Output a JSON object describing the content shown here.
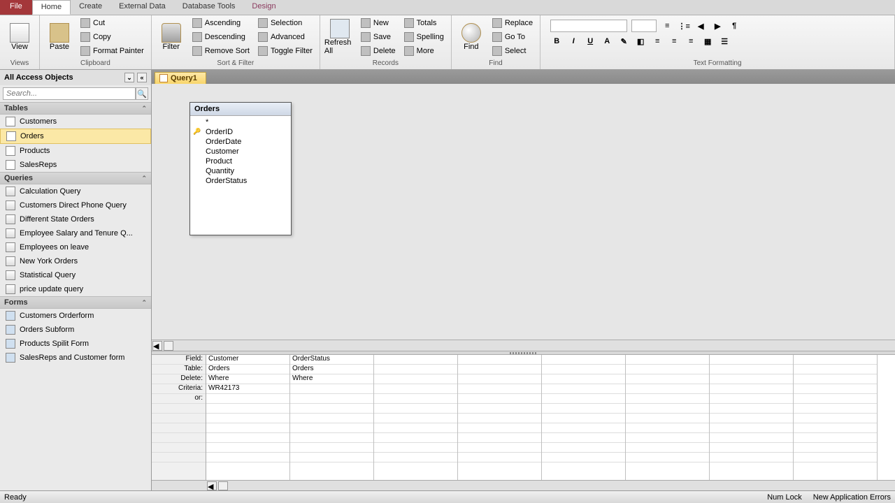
{
  "ribbon": {
    "tabs": {
      "file": "File",
      "home": "Home",
      "create": "Create",
      "external": "External Data",
      "dbtools": "Database Tools",
      "design": "Design"
    },
    "views": {
      "view": "View",
      "group": "Views"
    },
    "clipboard": {
      "paste": "Paste",
      "cut": "Cut",
      "copy": "Copy",
      "format_painter": "Format Painter",
      "group": "Clipboard"
    },
    "sortfilter": {
      "filter": "Filter",
      "ascending": "Ascending",
      "descending": "Descending",
      "remove_sort": "Remove Sort",
      "selection": "Selection",
      "advanced": "Advanced",
      "toggle_filter": "Toggle Filter",
      "group": "Sort & Filter"
    },
    "records": {
      "refresh": "Refresh All",
      "new": "New",
      "save": "Save",
      "delete": "Delete",
      "totals": "Totals",
      "spelling": "Spelling",
      "more": "More",
      "group": "Records"
    },
    "find": {
      "find": "Find",
      "replace": "Replace",
      "goto": "Go To",
      "select": "Select",
      "group": "Find"
    },
    "text": {
      "group": "Text Formatting"
    }
  },
  "sidebar": {
    "title": "All Access Objects",
    "search_placeholder": "Search...",
    "sections": {
      "tables": {
        "label": "Tables",
        "items": [
          "Customers",
          "Orders",
          "Products",
          "SalesReps"
        ]
      },
      "queries": {
        "label": "Queries",
        "items": [
          "Calculation Query",
          "Customers Direct Phone Query",
          "Different State Orders",
          "Employee Salary and Tenure Q...",
          "Employees on leave",
          "New York Orders",
          "Statistical Query",
          "price update query"
        ]
      },
      "forms": {
        "label": "Forms",
        "items": [
          "Customers Orderform",
          "Orders Subform",
          "Products Spilit Form",
          "SalesReps and Customer form"
        ]
      }
    }
  },
  "workspace": {
    "tab": "Query1",
    "table_box": {
      "title": "Orders",
      "fields": [
        "OrderID",
        "OrderDate",
        "Customer",
        "Product",
        "Quantity",
        "OrderStatus"
      ]
    },
    "star": "*"
  },
  "grid": {
    "labels": {
      "field": "Field:",
      "table": "Table:",
      "delete": "Delete:",
      "criteria": "Criteria:",
      "or": "or:"
    },
    "cols": [
      {
        "field": "Customer",
        "table": "Orders",
        "delete": "Where",
        "criteria": "WR42173"
      },
      {
        "field": "OrderStatus",
        "table": "Orders",
        "delete": "Where",
        "criteria": ""
      }
    ]
  },
  "status": {
    "ready": "Ready",
    "numlock": "Num Lock",
    "errors": "New Application Errors"
  }
}
